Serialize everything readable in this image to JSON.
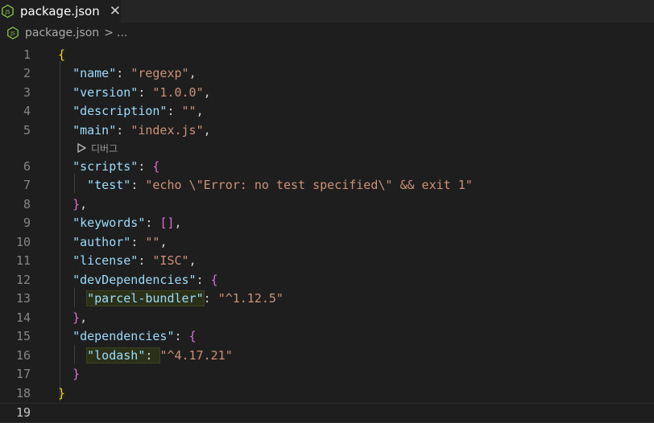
{
  "tab": {
    "label": "package.json",
    "close_icon": "close-icon",
    "file_icon": "nodejs-icon"
  },
  "breadcrumb": {
    "file": "package.json",
    "separator": ">",
    "ellipsis": "..."
  },
  "codelens": {
    "label": "디버그",
    "icon": "play-icon"
  },
  "lines": [
    {
      "num": "1"
    },
    {
      "num": "2"
    },
    {
      "num": "3"
    },
    {
      "num": "4"
    },
    {
      "num": "5"
    },
    {
      "num": "6"
    },
    {
      "num": "7"
    },
    {
      "num": "8"
    },
    {
      "num": "9"
    },
    {
      "num": "10"
    },
    {
      "num": "11"
    },
    {
      "num": "12"
    },
    {
      "num": "13"
    },
    {
      "num": "14"
    },
    {
      "num": "15"
    },
    {
      "num": "16"
    },
    {
      "num": "17"
    },
    {
      "num": "18"
    },
    {
      "num": "19"
    }
  ],
  "json": {
    "name_key": "\"name\"",
    "name_val": "\"regexp\"",
    "version_key": "\"version\"",
    "version_val": "\"1.0.0\"",
    "description_key": "\"description\"",
    "description_val": "\"\"",
    "main_key": "\"main\"",
    "main_val": "\"index.js\"",
    "scripts_key": "\"scripts\"",
    "test_key": "\"test\"",
    "test_val": "\"echo \\\"Error: no test specified\\\" && exit 1\"",
    "keywords_key": "\"keywords\"",
    "keywords_val": "[]",
    "author_key": "\"author\"",
    "author_val": "\"\"",
    "license_key": "\"license\"",
    "license_val": "\"ISC\"",
    "devdeps_key": "\"devDependencies\"",
    "parcel_key": "\"parcel-bundler\"",
    "parcel_val": "\"^1.12.5\"",
    "deps_key": "\"dependencies\"",
    "lodash_key": "\"lodash\"",
    "lodash_val": "\"^4.17.21\""
  },
  "colors": {
    "background": "#1e1e1e",
    "key": "#9cdcfe",
    "string": "#ce9178",
    "bracket_level1": "#ffd700",
    "bracket_level2": "#da70d6",
    "bracket_level3": "#179fff"
  }
}
